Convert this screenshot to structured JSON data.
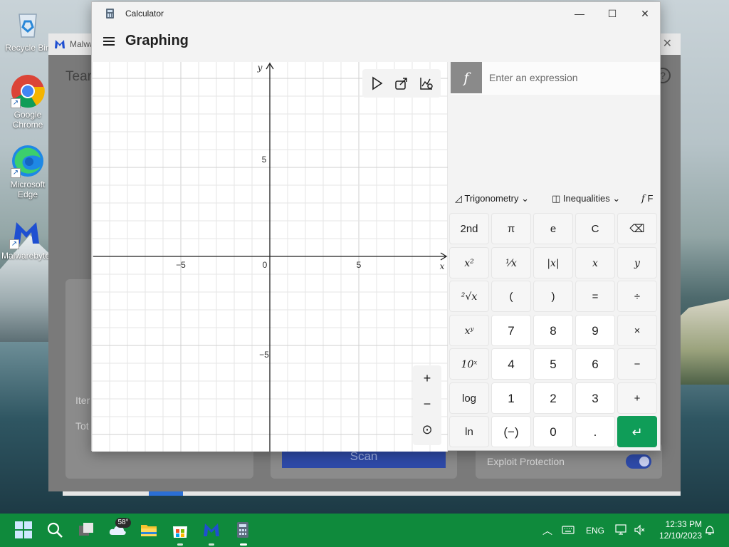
{
  "desktop": {
    "icons": [
      {
        "label": "Recycle Bin"
      },
      {
        "label": "Google Chrome"
      },
      {
        "label": "Microsoft Edge"
      },
      {
        "label": "Malwarebytes"
      }
    ]
  },
  "malwarebytes": {
    "title": "Malwa",
    "heading": "Tear",
    "help": "?",
    "card_item_label": "Iter",
    "card_total_label": "Tot",
    "scan_label": "Scan",
    "exploit_label": "Exploit Protection",
    "exploit_enabled": true
  },
  "calculator": {
    "window_title": "Calculator",
    "mode": "Graphing",
    "window_controls": {
      "minimize": "—",
      "maximize": "☐",
      "close": "✕"
    },
    "expression": {
      "fx": "f",
      "placeholder": "Enter an expression"
    },
    "graph": {
      "x_label": "x",
      "y_label": "y",
      "x_ticks": [
        "−5",
        "0",
        "5"
      ],
      "y_ticks": [
        "5",
        "−5"
      ]
    },
    "zoom": {
      "in": "+",
      "out": "−",
      "reset": "⊙"
    },
    "function_tabs": [
      {
        "label": "Trigonometry",
        "icon": "triangle-icon"
      },
      {
        "label": "Inequalities",
        "icon": "inequality-icon"
      },
      {
        "label": "F",
        "icon": "function-icon"
      }
    ],
    "keypad": [
      [
        "2nd",
        "π",
        "e",
        "C",
        "⌫"
      ],
      [
        "x²",
        "¹⁄x",
        "|x|",
        "x",
        "y"
      ],
      [
        "²√x",
        "(",
        ")",
        "=",
        "÷"
      ],
      [
        "xʸ",
        "7",
        "8",
        "9",
        "×"
      ],
      [
        "10ˣ",
        "4",
        "5",
        "6",
        "−"
      ],
      [
        "log",
        "1",
        "2",
        "3",
        "+"
      ],
      [
        "ln",
        "(−)",
        "0",
        ".",
        "↵"
      ]
    ]
  },
  "taskbar": {
    "weather_temp": "58°",
    "language": "ENG",
    "time": "12:33 PM",
    "date": "12/10/2023",
    "accent_color": "#0f8a3c"
  }
}
